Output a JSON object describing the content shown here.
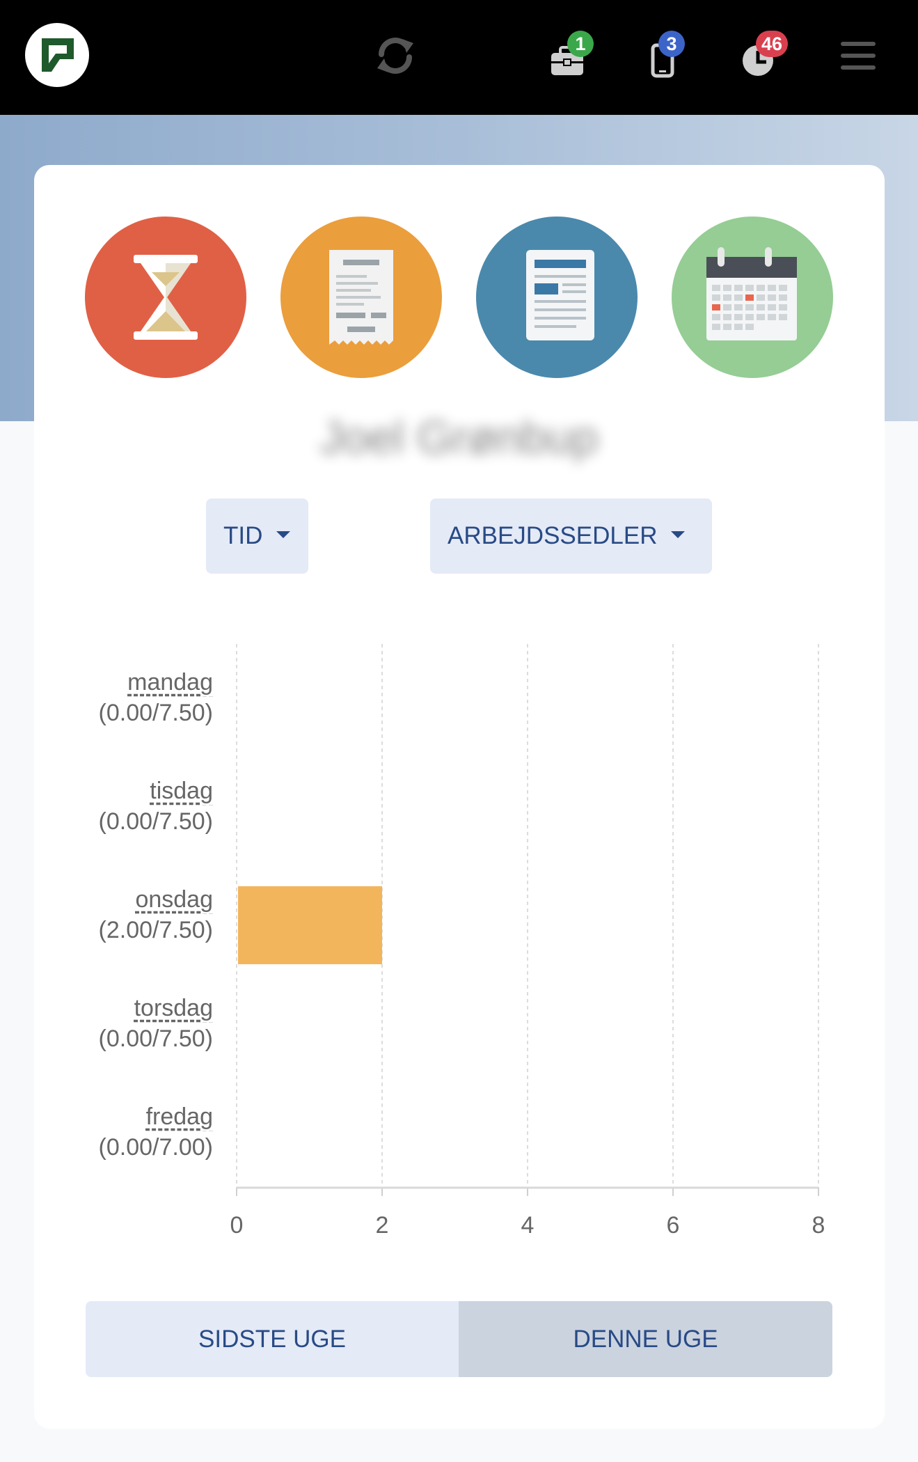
{
  "app": {
    "name": ""
  },
  "topbar": {
    "icons": [
      "logo-icon",
      "sync-icon",
      "briefcase-icon",
      "phone-icon",
      "clock-icon",
      "menu-icon"
    ],
    "badges": {
      "briefcase": {
        "count": "1",
        "color": "#3aa84a"
      },
      "phone": {
        "count": "3",
        "color": "#3c64c8"
      },
      "clock": {
        "count": "46",
        "color": "#d9404f"
      }
    }
  },
  "shortcuts": [
    {
      "icon": "hourglass-icon",
      "color": "#e06046"
    },
    {
      "icon": "receipt-icon",
      "color": "#eb9e3c"
    },
    {
      "icon": "document-icon",
      "color": "#4a89ac"
    },
    {
      "icon": "calendar-icon",
      "color": "#95cd95"
    }
  ],
  "user": {
    "name": "Joel Grønbup"
  },
  "filters": {
    "type_label": "TID",
    "category_label": "ARBEJDSSEDLER"
  },
  "chart_data": {
    "type": "bar",
    "orientation": "horizontal",
    "categories": [
      "mandag",
      "tisdag",
      "onsdag",
      "torsdag",
      "fredag"
    ],
    "category_labels": [
      "(0.00/7.50)",
      "(0.00/7.50)",
      "(2.00/7.50)",
      "(0.00/7.50)",
      "(0.00/7.00)"
    ],
    "values": [
      0,
      0,
      2,
      0,
      0
    ],
    "xlim": [
      0,
      8
    ],
    "xticks": [
      "0",
      "2",
      "4",
      "6",
      "8"
    ],
    "grid": true,
    "bar_color": "#f3b55c"
  },
  "week_toggle": {
    "last_week": "SIDSTE UGE",
    "this_week": "DENNE UGE",
    "selected": "this_week"
  }
}
